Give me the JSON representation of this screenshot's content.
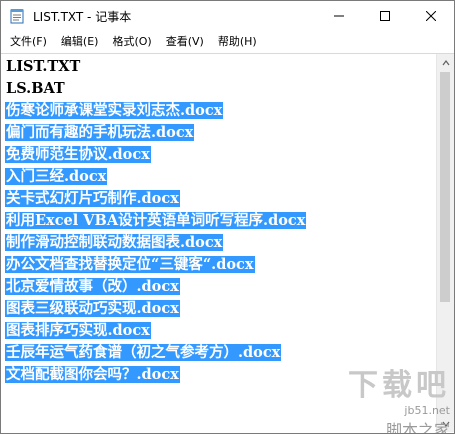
{
  "window": {
    "title": "LIST.TXT - 记事本"
  },
  "menu": [
    {
      "label": "文件(F)"
    },
    {
      "label": "编辑(E)"
    },
    {
      "label": "格式(O)"
    },
    {
      "label": "查看(V)"
    },
    {
      "label": "帮助(H)"
    }
  ],
  "editor": {
    "lines": [
      {
        "text": "LIST.TXT",
        "selected": false
      },
      {
        "text": "LS.BAT",
        "selected": false
      },
      {
        "text": "伤寒论师承课堂实录刘志杰.docx",
        "selected": true
      },
      {
        "text": "偏门而有趣的手机玩法.docx",
        "selected": true
      },
      {
        "text": "免费师范生协议.docx",
        "selected": true
      },
      {
        "text": "入门三经.docx",
        "selected": true
      },
      {
        "text": "关卡式幻灯片巧制作.docx",
        "selected": true
      },
      {
        "text": "利用Excel VBA设计英语单词听写程序.docx",
        "selected": true
      },
      {
        "text": "制作滑动控制联动数据图表.docx",
        "selected": true
      },
      {
        "text": "办公文档查找替换定位“三键客“.docx",
        "selected": true
      },
      {
        "text": "北京爱情故事（改）.docx",
        "selected": true
      },
      {
        "text": "图表三级联动巧实现.docx",
        "selected": true
      },
      {
        "text": "图表排序巧实现.docx",
        "selected": true
      },
      {
        "text": "壬辰年运气药食谱（初之气参考方）.docx",
        "selected": true
      },
      {
        "text": "文档配截图你会吗？.docx",
        "selected": true
      }
    ],
    "selection_color": "#3399ff"
  },
  "watermark": {
    "big": "下载吧",
    "url": "jb51.net",
    "cn": "脚本之家"
  }
}
